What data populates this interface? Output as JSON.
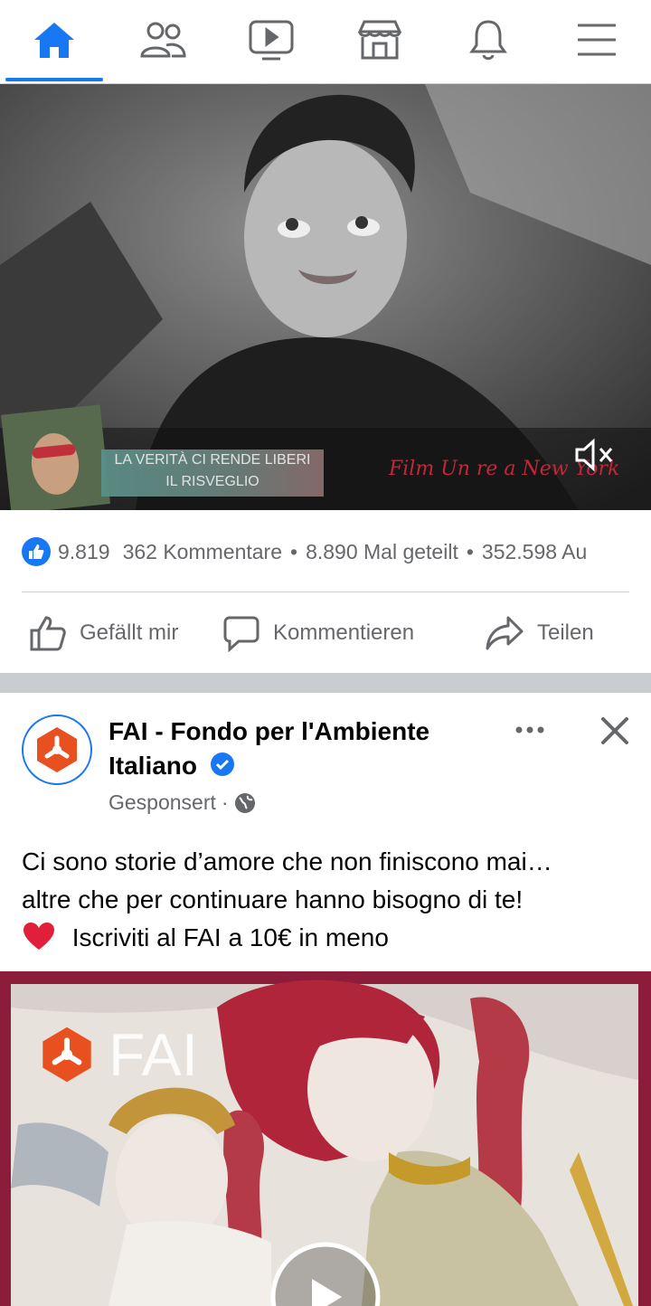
{
  "nav": {
    "tabs": [
      {
        "icon": "home-icon",
        "active": true
      },
      {
        "icon": "friends-icon"
      },
      {
        "icon": "watch-icon"
      },
      {
        "icon": "marketplace-icon"
      },
      {
        "icon": "notifications-icon"
      },
      {
        "icon": "menu-icon"
      }
    ],
    "accent": "#1877f2"
  },
  "video_post": {
    "overlay_caption_line1": "LA VERITÀ CI RENDE LIBERI",
    "overlay_caption_line2": "IL RISVEGLIO",
    "overlay_film_text": "Film Un re a New York",
    "reactions_count": "9.819",
    "comments": "362 Kommentare",
    "shares": "8.890 Mal geteilt",
    "views": "352.598 Au",
    "actions": {
      "like": "Gefällt mir",
      "comment": "Kommentieren",
      "share": "Teilen"
    }
  },
  "ad_post": {
    "page_name": "FAI - Fondo per l'Ambiente Italiano",
    "sponsored": "Gesponsert",
    "text_line1": "Ci sono storie d’amore che non finiscono mai…",
    "text_line2": "altre che per continuare hanno bisogno di te!",
    "text_line3": "Iscriviti al FAI a 10€ in meno",
    "media_logo": "FAI",
    "brand_color": "#e8501f"
  }
}
